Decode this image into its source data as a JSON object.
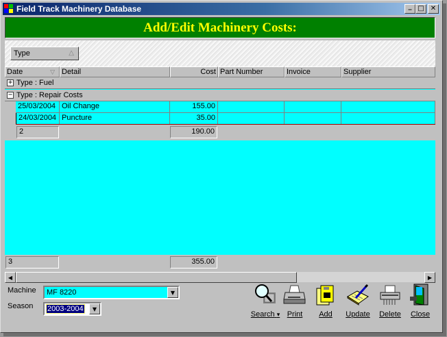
{
  "window": {
    "title": "Field Track Machinery Database"
  },
  "title_buttons": {
    "minimize": "_",
    "maximize": "□",
    "close": "✕"
  },
  "banner": {
    "heading": "Add/Edit Machinery Costs:"
  },
  "grouping": {
    "chip_label": "Type"
  },
  "grid": {
    "columns": [
      "Date",
      "Detail",
      "Cost",
      "Part Number",
      "Invoice",
      "Supplier"
    ],
    "groups": [
      {
        "label": "Type : Fuel",
        "expanded": false,
        "toggle": "+"
      },
      {
        "label": "Type : Repair Costs",
        "expanded": true,
        "toggle": "−",
        "rows": [
          {
            "date": "25/03/2004",
            "detail": "Oil Change",
            "cost": "155.00",
            "part_number": "",
            "invoice": "",
            "supplier": ""
          },
          {
            "date": "24/03/2004",
            "detail": "Puncture",
            "cost": "35.00",
            "part_number": "",
            "invoice": "",
            "supplier": ""
          }
        ],
        "summary": {
          "count": "2",
          "cost_total": "190.00"
        }
      }
    ],
    "footer": {
      "count": "3",
      "cost_total": "355.00"
    },
    "highlight_color": "#00ffff"
  },
  "filters": {
    "machine_label": "Machine",
    "machine_value": "MF 8220",
    "season_label": "Season",
    "season_value": "2003-2004"
  },
  "toolbar": {
    "search": "Search",
    "search_dropdown": "▾",
    "print": "Print",
    "add": "Add",
    "update": "Update",
    "delete": "Delete",
    "close": "Close"
  }
}
